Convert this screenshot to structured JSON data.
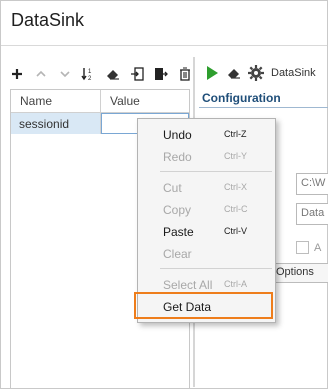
{
  "window": {
    "title": "DataSink"
  },
  "left_toolbar": {
    "icons": [
      "add-icon",
      "move-up-icon",
      "move-down-icon",
      "sort-icon",
      "eraser-icon",
      "import-icon",
      "export-icon",
      "delete-icon"
    ]
  },
  "grid": {
    "columns": [
      "Name",
      "Value"
    ],
    "rows": [
      {
        "name": "sessionid",
        "value": ""
      }
    ]
  },
  "right_toolbar": {
    "icons": [
      "run-icon",
      "eraser-icon",
      "gear-icon"
    ],
    "crumb": "DataSink"
  },
  "configuration": {
    "title": "Configuration",
    "field1": "C:\\W",
    "field2": "Data",
    "checkbox_label": "A",
    "tab_label": "Options"
  },
  "context_menu": {
    "items": [
      {
        "label": "Undo",
        "shortcut": "Ctrl-Z",
        "enabled": true
      },
      {
        "label": "Redo",
        "shortcut": "Ctrl-Y",
        "enabled": false
      },
      {
        "label": "Cut",
        "shortcut": "Ctrl-X",
        "enabled": false
      },
      {
        "label": "Copy",
        "shortcut": "Ctrl-C",
        "enabled": false
      },
      {
        "label": "Paste",
        "shortcut": "Ctrl-V",
        "enabled": true
      },
      {
        "label": "Clear",
        "shortcut": "",
        "enabled": false
      },
      {
        "label": "Select All",
        "shortcut": "Ctrl-A",
        "enabled": false
      },
      {
        "label": "Get Data",
        "shortcut": "",
        "enabled": true,
        "highlighted": true
      }
    ],
    "highlight_color": "#ee7d1b"
  },
  "colors": {
    "accent": "#1f4e79",
    "selection": "#d9e8f5",
    "run_green": "#2e9e2e"
  }
}
